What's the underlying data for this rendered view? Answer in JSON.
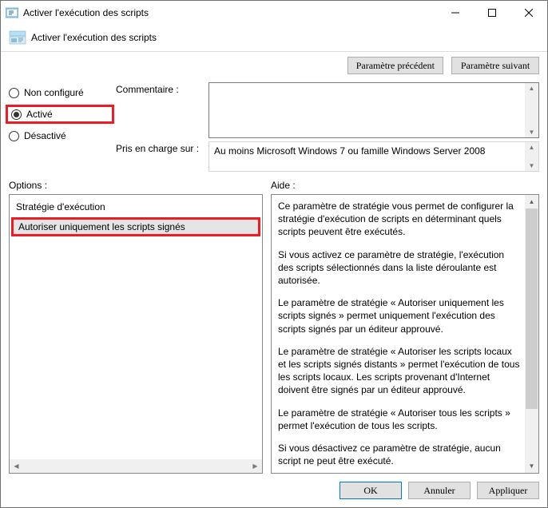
{
  "window": {
    "title": "Activer l'exécution des scripts"
  },
  "header": {
    "subtitle": "Activer l'exécution des scripts"
  },
  "nav_buttons": {
    "prev": "Paramètre précédent",
    "next": "Paramètre suivant"
  },
  "radios": {
    "not_configured": "Non configuré",
    "enabled": "Activé",
    "disabled": "Désactivé"
  },
  "fields": {
    "comment_label": "Commentaire :",
    "supported_label": "Pris en charge sur :",
    "supported_value": "Au moins Microsoft Windows 7 ou famille Windows Server 2008"
  },
  "section_labels": {
    "options": "Options :",
    "help": "Aide :"
  },
  "options": {
    "policy_label": "Stratégie d'exécution",
    "selected_value": "Autoriser uniquement les scripts signés"
  },
  "help": {
    "p1": "Ce paramètre de stratégie vous permet de configurer la stratégie d'exécution de scripts en déterminant quels scripts peuvent être exécutés.",
    "p2": "Si vous activez ce paramètre de stratégie, l'exécution des scripts sélectionnés dans la liste déroulante est autorisée.",
    "p3": "Le paramètre de stratégie « Autoriser uniquement les scripts signés » permet uniquement l'exécution des scripts signés par un éditeur approuvé.",
    "p4": "Le paramètre de stratégie « Autoriser les scripts locaux et les scripts signés distants » permet l'exécution de tous les scripts locaux. Les scripts provenant d'Internet doivent être signés par un éditeur approuvé.",
    "p5": "Le paramètre de stratégie « Autoriser tous les scripts » permet l'exécution de tous les scripts.",
    "p6": "Si vous désactivez ce paramètre de stratégie, aucun script ne peut être exécuté."
  },
  "footer": {
    "ok": "OK",
    "cancel": "Annuler",
    "apply": "Appliquer"
  }
}
